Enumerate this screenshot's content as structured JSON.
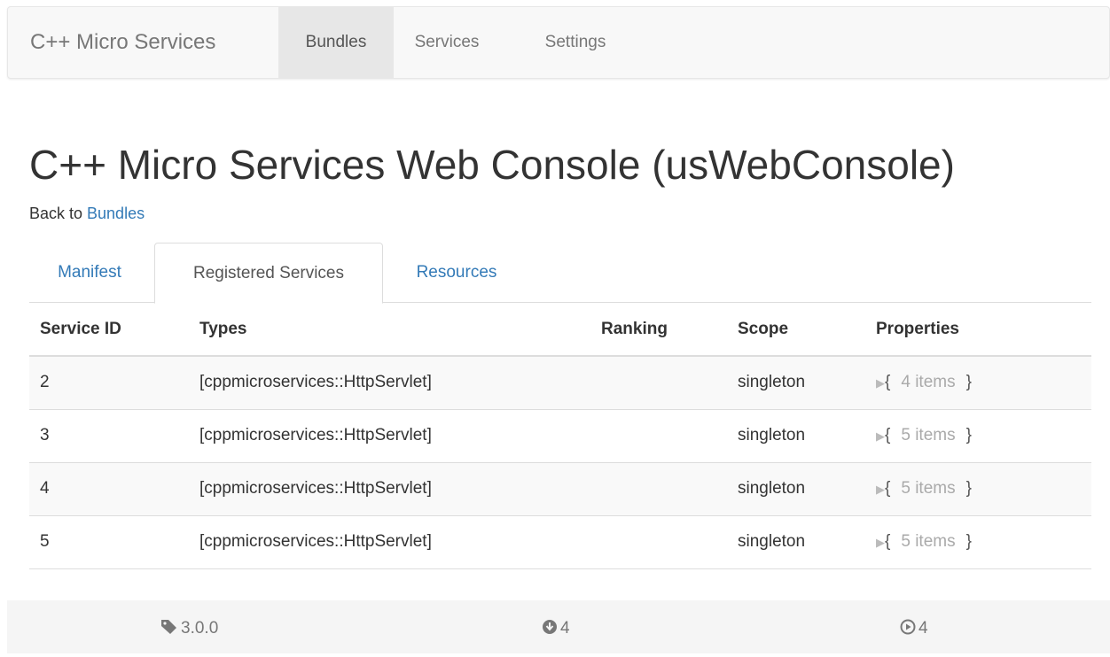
{
  "navbar": {
    "brand": "C++ Micro Services",
    "items": [
      {
        "label": "Bundles",
        "active": true
      },
      {
        "label": "Services",
        "active": false
      },
      {
        "label": "Settings",
        "active": false
      }
    ]
  },
  "page": {
    "title": "C++ Micro Services Web Console (usWebConsole)",
    "back_prefix": "Back to ",
    "back_link": "Bundles"
  },
  "tabs": [
    {
      "label": "Manifest",
      "active": false
    },
    {
      "label": "Registered Services",
      "active": true
    },
    {
      "label": "Resources",
      "active": false
    }
  ],
  "table": {
    "headers": [
      "Service ID",
      "Types",
      "Ranking",
      "Scope",
      "Properties"
    ],
    "rows": [
      {
        "id": "2",
        "types": "[cppmicroservices::HttpServlet]",
        "ranking": "",
        "scope": "singleton",
        "open": "{",
        "count": "4 items",
        "close": "}"
      },
      {
        "id": "3",
        "types": "[cppmicroservices::HttpServlet]",
        "ranking": "",
        "scope": "singleton",
        "open": "{",
        "count": "5 items",
        "close": "}"
      },
      {
        "id": "4",
        "types": "[cppmicroservices::HttpServlet]",
        "ranking": "",
        "scope": "singleton",
        "open": "{",
        "count": "5 items",
        "close": "}"
      },
      {
        "id": "5",
        "types": "[cppmicroservices::HttpServlet]",
        "ranking": "",
        "scope": "singleton",
        "open": "{",
        "count": "5 items",
        "close": "}"
      }
    ]
  },
  "footer": {
    "version": "3.0.0",
    "installed": "4",
    "active": "4",
    "icons": {
      "version": "tag-icon",
      "installed": "download-circle-icon",
      "active": "play-circle-icon"
    }
  },
  "colors": {
    "link": "#337ab7",
    "navbar_bg": "#f8f8f8",
    "active_nav_bg": "#e7e7e7",
    "striped_row": "#f9f9f9",
    "footer_bg": "#f5f5f5"
  }
}
